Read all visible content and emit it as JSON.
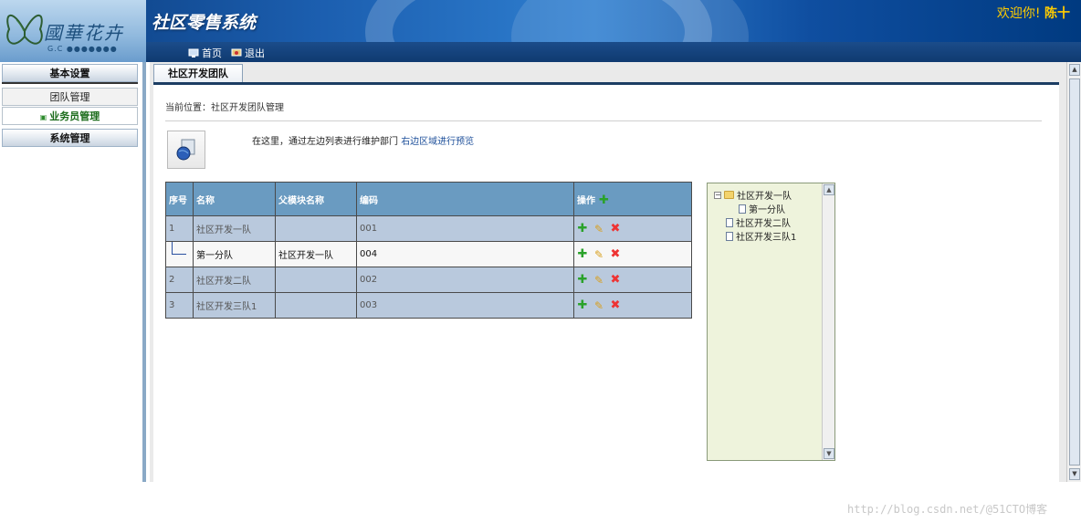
{
  "header": {
    "logo_text": "國華花卉",
    "logo_sub": "G.C ●●●●●●●",
    "title": "社区零售系统",
    "welcome": "欢迎你!",
    "user": "陈十",
    "nav": [
      {
        "label": "首页",
        "icon": "home-icon"
      },
      {
        "label": "退出",
        "icon": "logout-icon"
      }
    ]
  },
  "sidebar": {
    "sections": [
      {
        "title": "基本设置",
        "items": [
          "团队管理",
          "业务员管理"
        ]
      },
      {
        "title": "系统管理",
        "items": []
      }
    ],
    "active_item": "业务员管理"
  },
  "tab": {
    "label": "社区开发团队"
  },
  "breadcrumb": "当前位置：社区开发团队管理",
  "hint": {
    "text": "在这里，通过左边列表进行维护部门",
    "link": "右边区域进行预览"
  },
  "table": {
    "columns": [
      "序号",
      "名称",
      "父模块名称",
      "编码",
      "操作"
    ],
    "rows": [
      {
        "index": "1",
        "name": "社区开发一队",
        "parent": "",
        "code": "001",
        "child": false
      },
      {
        "index": "",
        "name": "第一分队",
        "parent": "社区开发一队",
        "code": "004",
        "child": true
      },
      {
        "index": "2",
        "name": "社区开发二队",
        "parent": "",
        "code": "002",
        "child": false
      },
      {
        "index": "3",
        "name": "社区开发三队1",
        "parent": "",
        "code": "003",
        "child": false
      }
    ]
  },
  "tree": [
    {
      "label": "社区开发一队",
      "type": "folder",
      "level": 0
    },
    {
      "label": "第一分队",
      "type": "doc",
      "level": 1
    },
    {
      "label": "社区开发二队",
      "type": "doc",
      "level": 0
    },
    {
      "label": "社区开发三队1",
      "type": "doc",
      "level": 0
    }
  ],
  "watermark": "http://blog.csdn.net/@51CTO博客",
  "colors": {
    "header_blue": "#1c5fb0",
    "table_header": "#6a9bc1",
    "row_blue": "#b9c9dd",
    "tree_bg": "#eef3dc",
    "welcome_yellow": "#ffcc00"
  }
}
